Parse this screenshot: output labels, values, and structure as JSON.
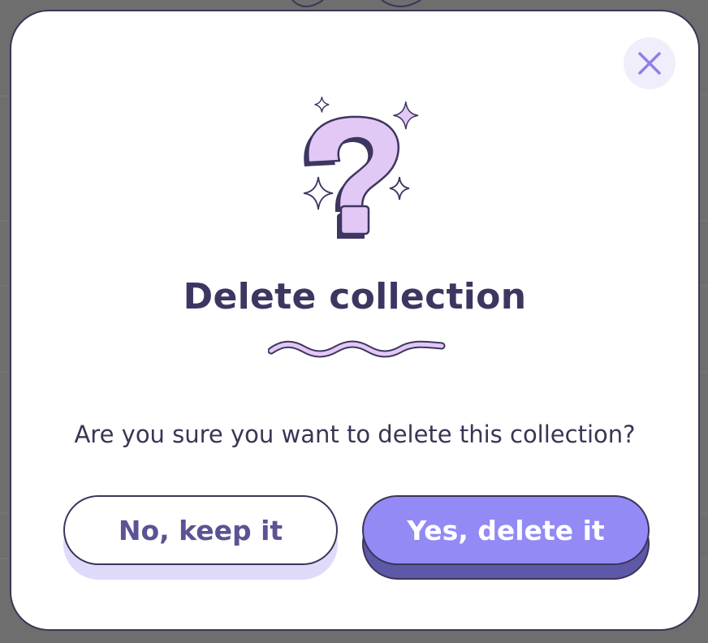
{
  "dialog": {
    "title": "Delete collection",
    "message": "Are you sure you want to delete this collection?",
    "cancel_label": "No, keep it",
    "confirm_label": "Yes, delete it",
    "icons": {
      "close": "close-icon",
      "illustration": "question-mark-icon",
      "decoration": "sparkle-icon"
    }
  },
  "colors": {
    "accent": "#938af5",
    "accent_dark": "#5e58a8",
    "illustration_fill": "#e2c8f5",
    "text_dark": "#3d3660",
    "close_icon": "#8b80ea"
  }
}
